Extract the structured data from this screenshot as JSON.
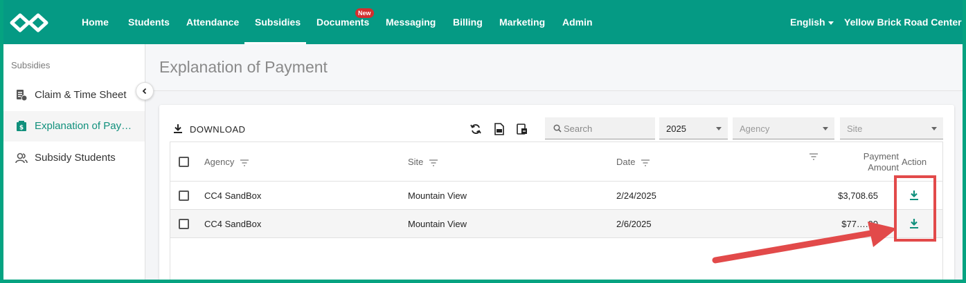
{
  "nav": {
    "items": [
      "Home",
      "Students",
      "Attendance",
      "Subsidies",
      "Documents",
      "Messaging",
      "Billing",
      "Marketing",
      "Admin"
    ],
    "new_badge": "New",
    "language": "English",
    "center": "Yellow Brick Road Center"
  },
  "sidebar": {
    "title": "Subsidies",
    "items": [
      "Claim & Time Sheet",
      "Explanation of Payment",
      "Subsidy Students"
    ]
  },
  "page": {
    "title": "Explanation of Payment"
  },
  "toolbar": {
    "download_label": "DOWNLOAD",
    "search_placeholder": "Search",
    "year": "2025",
    "agency_placeholder": "Agency",
    "site_placeholder": "Site"
  },
  "table": {
    "headers": {
      "agency": "Agency",
      "site": "Site",
      "date": "Date",
      "payment_line1": "Payment",
      "payment_line2": "Amount",
      "action": "Action"
    },
    "rows": [
      {
        "agency": "CC4 SandBox",
        "site": "Mountain View",
        "date": "2/24/2025",
        "amount": "$3,708.65"
      },
      {
        "agency": "CC4 SandBox",
        "site": "Mountain View",
        "date": "2/6/2025",
        "amount": "$77….00"
      }
    ]
  },
  "colors": {
    "brand": "#059a84",
    "accent_text": "#10907c",
    "annotation": "#e24a4a"
  }
}
